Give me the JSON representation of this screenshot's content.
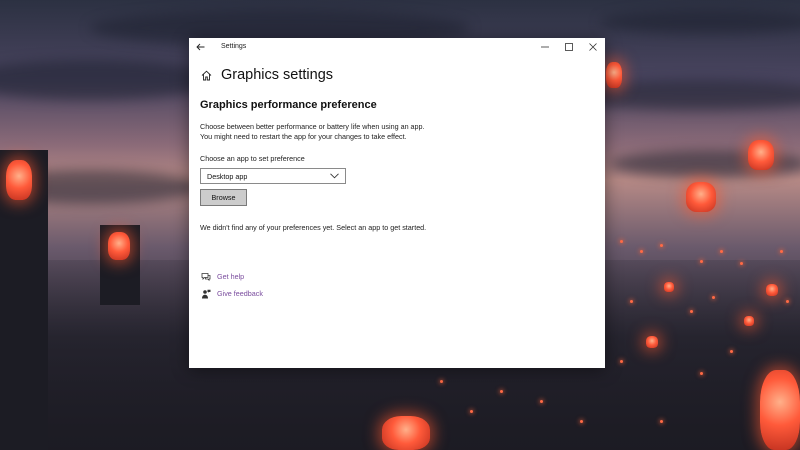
{
  "window": {
    "title": "Settings",
    "back_icon": "back-arrow-icon",
    "controls": {
      "minimize_icon": "minimize-icon",
      "maximize_icon": "maximize-icon",
      "close_icon": "close-icon"
    }
  },
  "header": {
    "home_icon": "home-icon",
    "title": "Graphics settings"
  },
  "section": {
    "title": "Graphics performance preference",
    "description_line1": "Choose between better performance or battery life when using an app.",
    "description_line2": "You might need to restart the app for your changes to take effect."
  },
  "app_picker": {
    "label": "Choose an app to set preference",
    "selected": "Desktop app",
    "browse_label": "Browse"
  },
  "empty_message": "We didn't find any of your preferences yet. Select an app to get started.",
  "help_links": [
    {
      "label": "Get help",
      "icon": "chat-help-icon"
    },
    {
      "label": "Give feedback",
      "icon": "feedback-person-icon"
    }
  ],
  "colors": {
    "link": "#7a4c9e",
    "window_bg": "#ffffff",
    "button_bg": "#cccccc"
  }
}
